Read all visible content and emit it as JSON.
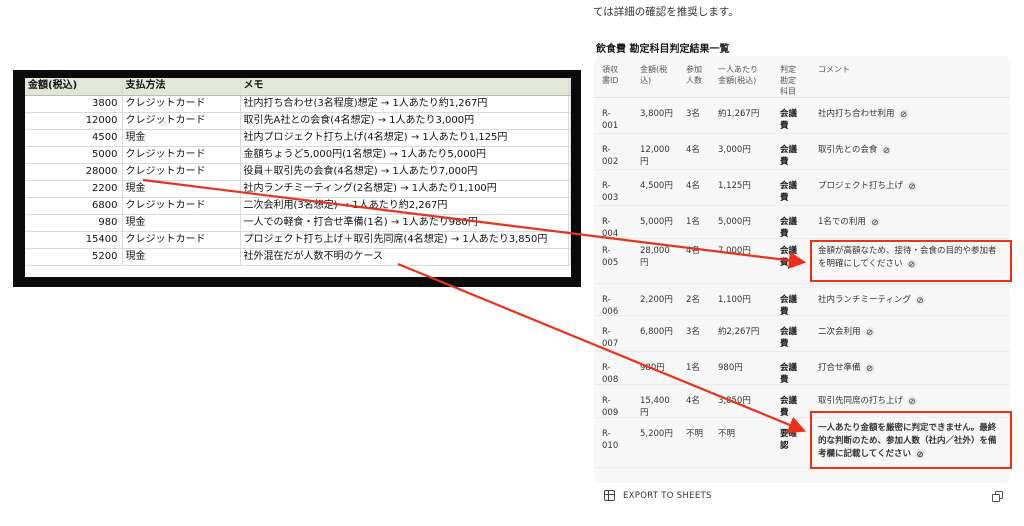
{
  "intro_text": "ては詳細の確認を推奨します。",
  "panel_title": "飲食費 勘定科目判定結果一覧",
  "spreadsheet": {
    "headers": [
      "金額(税込)",
      "支払方法",
      "メモ"
    ],
    "rows": [
      {
        "amount": "3800",
        "method": "クレジットカード",
        "memo": "社内打ち合わせ(3名程度)想定 → 1人あたり約1,267円"
      },
      {
        "amount": "12000",
        "method": "クレジットカード",
        "memo": "取引先A社との会食(4名想定) → 1人あたり3,000円"
      },
      {
        "amount": "4500",
        "method": "現金",
        "memo": "社内プロジェクト打ち上げ(4名想定) → 1人あたり1,125円"
      },
      {
        "amount": "5000",
        "method": "クレジットカード",
        "memo": "金額ちょうど5,000円(1名想定) → 1人あたり5,000円"
      },
      {
        "amount": "28000",
        "method": "クレジットカード",
        "memo": "役員＋取引先の会食(4名想定) → 1人あたり7,000円"
      },
      {
        "amount": "2200",
        "method": "現金",
        "memo": "社内ランチミーティング(2名想定) → 1人あたり1,100円"
      },
      {
        "amount": "6800",
        "method": "クレジットカード",
        "memo": "二次会利用(3名想定) → 1人あたり約2,267円"
      },
      {
        "amount": "980",
        "method": "現金",
        "memo": "一人での軽食・打合せ準備(1名) → 1人あたり980円"
      },
      {
        "amount": "15400",
        "method": "クレジットカード",
        "memo": "プロジェクト打ち上げ＋取引先同席(4名想定) → 1人あたり3,850円"
      },
      {
        "amount": "5200",
        "method": "現金",
        "memo": "社外混在だが人数不明のケース"
      }
    ]
  },
  "results": {
    "headers": {
      "id": "領収\n書ID",
      "amount": "金額(税\n込)",
      "people": "参加\n人数",
      "per_person": "一人あたり\n金額(税込)",
      "decision": "判定\n勘定\n科目",
      "comment": "コメント"
    },
    "rows": [
      {
        "id": "R-\n001",
        "amount": "3,800円",
        "people": "3名",
        "per_person": "約1,267円",
        "decision": "会議\n費",
        "comment": "社内打ち合わせ利用"
      },
      {
        "id": "R-\n002",
        "amount": "12,000\n円",
        "people": "4名",
        "per_person": "3,000円",
        "decision": "会議\n費",
        "comment": "取引先との会食"
      },
      {
        "id": "R-\n003",
        "amount": "4,500円",
        "people": "4名",
        "per_person": "1,125円",
        "decision": "会議\n費",
        "comment": "プロジェクト打ち上げ"
      },
      {
        "id": "R-\n004",
        "amount": "5,000円",
        "people": "1名",
        "per_person": "5,000円",
        "decision": "会議\n費",
        "comment": "1名での利用"
      },
      {
        "id": "R-\n005",
        "amount": "28,000\n円",
        "people": "4名",
        "per_person": "7,000円",
        "decision": "会議\n費",
        "comment": "金額が高額なため、接待・会食の目的や参加者を明確にしてください"
      },
      {
        "id": "R-\n006",
        "amount": "2,200円",
        "people": "2名",
        "per_person": "1,100円",
        "decision": "会議\n費",
        "comment": "社内ランチミーティング"
      },
      {
        "id": "R-\n007",
        "amount": "6,800円",
        "people": "3名",
        "per_person": "約2,267円",
        "decision": "会議\n費",
        "comment": "二次会利用"
      },
      {
        "id": "R-\n008",
        "amount": "980円",
        "people": "1名",
        "per_person": "980円",
        "decision": "会議\n費",
        "comment": "打合せ準備"
      },
      {
        "id": "R-\n009",
        "amount": "15,400\n円",
        "people": "4名",
        "per_person": "3,850円",
        "decision": "会議\n費",
        "comment": "取引先同席の打ち上げ"
      },
      {
        "id": "R-\n010",
        "amount": "5,200円",
        "people": "不明",
        "per_person": "不明",
        "decision": "要確\n認",
        "comment": "一人あたり金額を厳密に判定できません。最終的な判断のため、参加人数（社内／社外）を備考欄に記載してください"
      }
    ]
  },
  "export_label": "EXPORT TO SHEETS",
  "icons": {
    "export": "sheets-grid-icon",
    "copy": "copy-icon",
    "link": "link-icon"
  },
  "colors": {
    "highlight": "#e8321b",
    "sheet_header": "#e2e7da",
    "card_bg": "#f7f7f7"
  }
}
